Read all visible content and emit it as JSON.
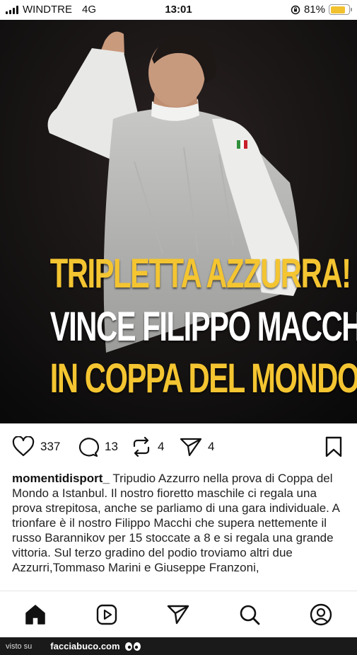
{
  "status_bar": {
    "carrier": "WINDTRE",
    "network": "4G",
    "time": "13:01",
    "battery": "81%",
    "battery_level": 0.81,
    "battery_color": "#f2c12e"
  },
  "post": {
    "headline_line1": "TRIPLETTA AZZURRA!",
    "headline_line2": "VINCE FILIPPO MACCHI",
    "headline_line3": "IN COPPA DEL MONDO",
    "headline_accent": "#f4c531",
    "likes": "337",
    "comments": "13",
    "reposts": "4",
    "shares": "4",
    "username": "momentidisport_",
    "caption": "Tripudio Azzurro nella prova di Coppa del Mondo a Istanbul. Il nostro fioretto maschile ci regala una prova strepitosa, anche se parliamo di una gara individuale. A trionfare è il nostro Filippo Macchi che supera nettemente il russo Barannikov per 15 stoccate a 8 e si regala una grande vittoria. Sul terzo gradino del podio troviamo altri due Azzurri,Tommaso Marini e Giuseppe Franzoni,"
  },
  "icons": {
    "like": "heart-icon",
    "comment": "comment-icon",
    "repost": "repost-icon",
    "share": "send-icon",
    "save": "bookmark-icon",
    "nav": [
      "home-icon",
      "reels-icon",
      "send-icon",
      "search-icon",
      "profile-icon"
    ]
  },
  "footer": {
    "visto": "visto su",
    "site": "facciabuco.com"
  }
}
